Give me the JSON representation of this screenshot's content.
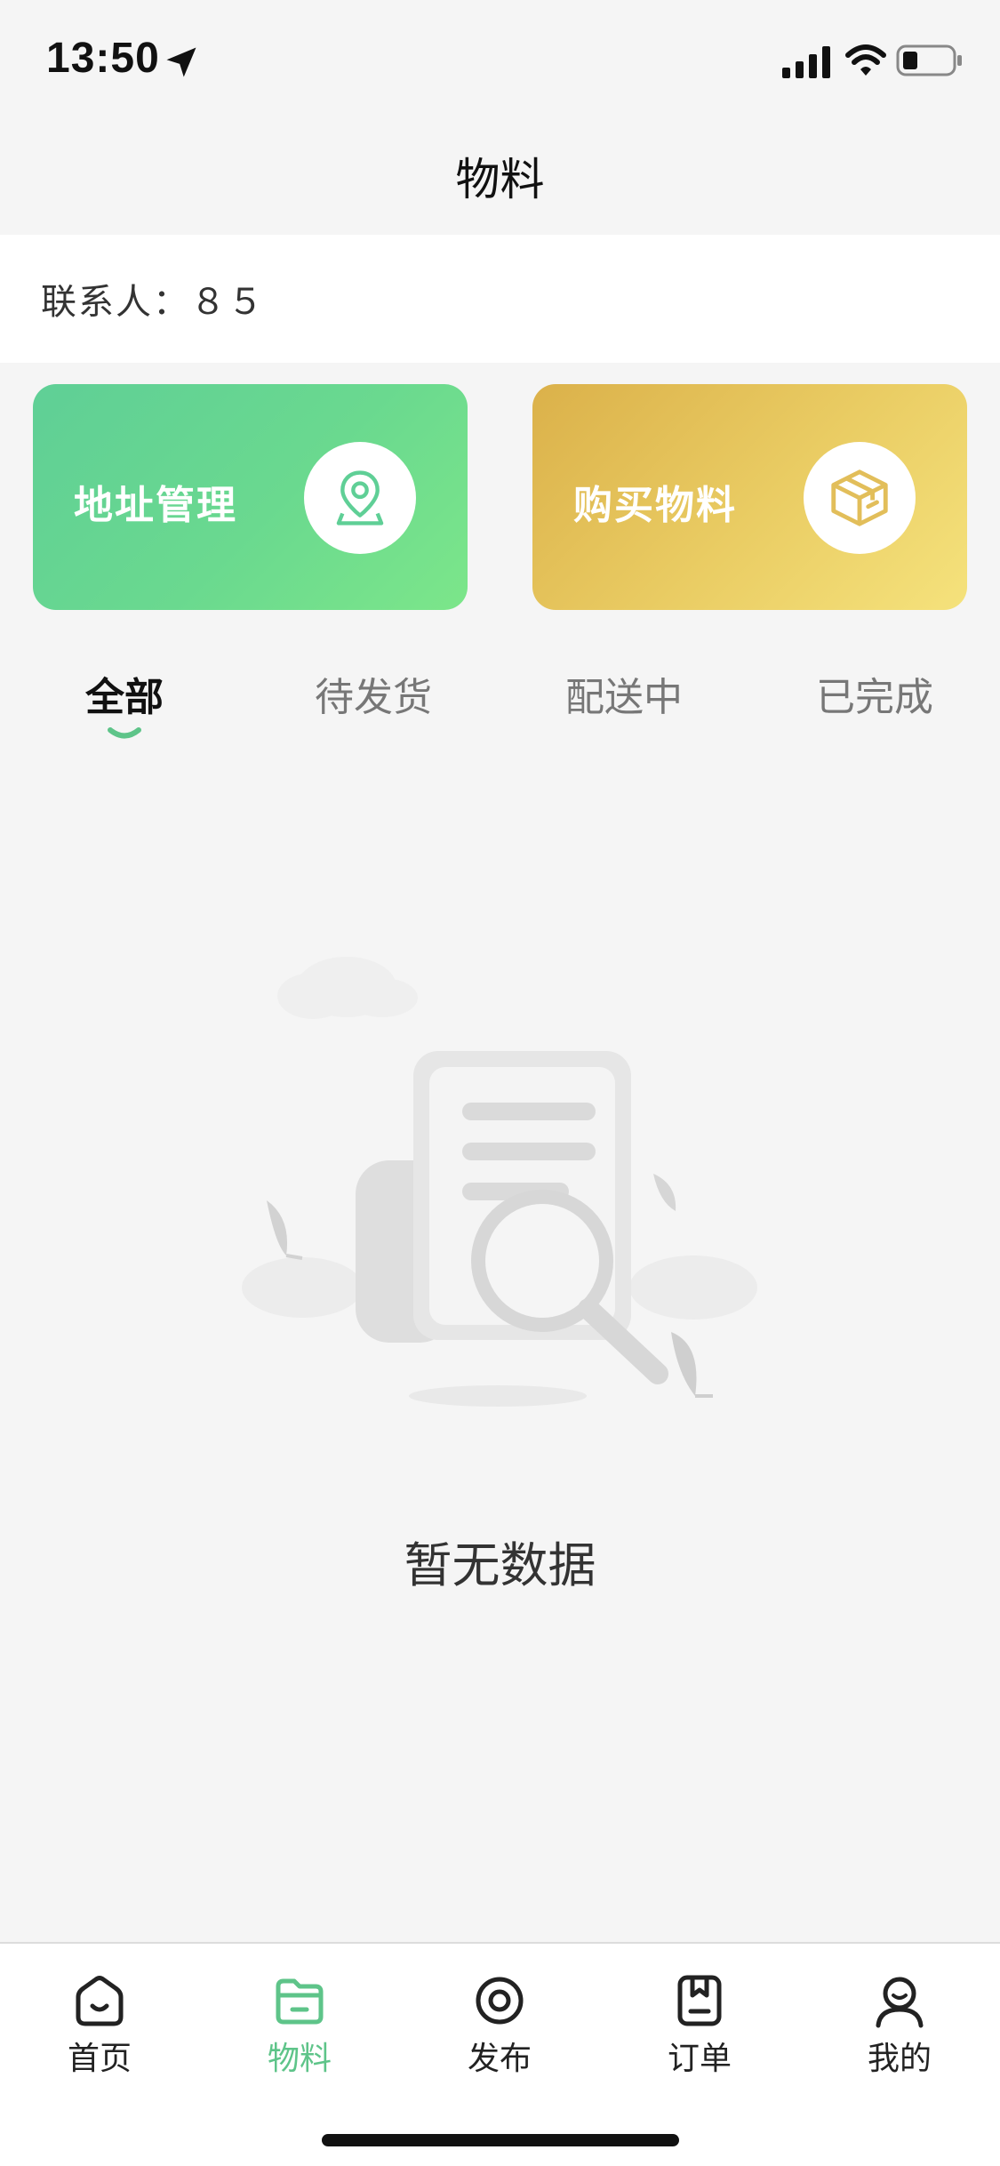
{
  "status_bar": {
    "time": "13:50",
    "icons": [
      "location-arrow-icon",
      "signal-icon",
      "wifi-icon",
      "battery-icon"
    ]
  },
  "nav": {
    "title": "物料"
  },
  "contact": {
    "text": "联系人：８５"
  },
  "cards": [
    {
      "label": "地址管理",
      "icon": "location-pin-icon",
      "color_start": "#5fcf96",
      "color_end": "#7ce68a"
    },
    {
      "label": "购买物料",
      "icon": "box-icon",
      "color_start": "#dbb14a",
      "color_end": "#f5e27c"
    }
  ],
  "tabs": [
    {
      "label": "全部",
      "active": true
    },
    {
      "label": "待发货",
      "active": false
    },
    {
      "label": "配送中",
      "active": false
    },
    {
      "label": "已完成",
      "active": false
    }
  ],
  "empty": {
    "text": "暂无数据"
  },
  "tabbar": [
    {
      "label": "首页",
      "icon": "home-icon",
      "active": false
    },
    {
      "label": "物料",
      "icon": "folder-icon",
      "active": true
    },
    {
      "label": "发布",
      "icon": "publish-icon",
      "active": false
    },
    {
      "label": "订单",
      "icon": "order-icon",
      "active": false
    },
    {
      "label": "我的",
      "icon": "profile-icon",
      "active": false
    }
  ],
  "colors": {
    "accent": "#5ec489",
    "background": "#f5f5f5"
  }
}
